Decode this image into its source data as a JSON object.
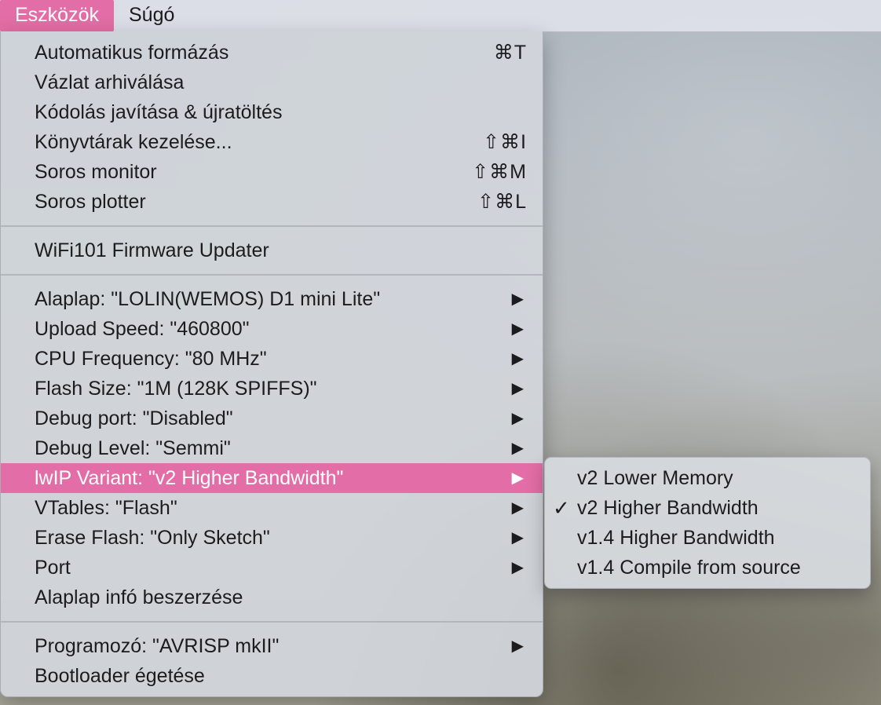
{
  "menubar": {
    "items": [
      {
        "label": "Eszközök",
        "active": true
      },
      {
        "label": "Súgó",
        "active": false
      }
    ]
  },
  "tools_menu": {
    "group1": [
      {
        "label": "Automatikus formázás",
        "shortcut": "⌘T"
      },
      {
        "label": "Vázlat arhiválása",
        "shortcut": ""
      },
      {
        "label": "Kódolás javítása & újratöltés",
        "shortcut": ""
      },
      {
        "label": "Könyvtárak kezelése...",
        "shortcut": "⇧⌘I"
      },
      {
        "label": "Soros monitor",
        "shortcut": "⇧⌘M"
      },
      {
        "label": "Soros plotter",
        "shortcut": "⇧⌘L"
      }
    ],
    "group2": [
      {
        "label": "WiFi101 Firmware Updater"
      }
    ],
    "group3": [
      {
        "label": "Alaplap: \"LOLIN(WEMOS) D1 mini Lite\"",
        "has_submenu": true
      },
      {
        "label": "Upload Speed: \"460800\"",
        "has_submenu": true
      },
      {
        "label": "CPU Frequency: \"80 MHz\"",
        "has_submenu": true
      },
      {
        "label": "Flash Size: \"1M (128K SPIFFS)\"",
        "has_submenu": true
      },
      {
        "label": "Debug port: \"Disabled\"",
        "has_submenu": true
      },
      {
        "label": "Debug Level: \"Semmi\"",
        "has_submenu": true
      },
      {
        "label": "lwIP Variant: \"v2 Higher Bandwidth\"",
        "has_submenu": true,
        "highlighted": true
      },
      {
        "label": "VTables: \"Flash\"",
        "has_submenu": true
      },
      {
        "label": "Erase Flash: \"Only Sketch\"",
        "has_submenu": true
      },
      {
        "label": "Port",
        "has_submenu": true
      },
      {
        "label": "Alaplap infó beszerzése",
        "has_submenu": false
      }
    ],
    "group4": [
      {
        "label": "Programozó: \"AVRISP mkII\"",
        "has_submenu": true
      },
      {
        "label": "Bootloader égetése",
        "has_submenu": false
      }
    ],
    "submenu_arrow": "▶"
  },
  "lwip_submenu": {
    "check_glyph": "✓",
    "items": [
      {
        "label": "v2 Lower Memory",
        "checked": false
      },
      {
        "label": "v2 Higher Bandwidth",
        "checked": true
      },
      {
        "label": "v1.4 Higher Bandwidth",
        "checked": false
      },
      {
        "label": "v1.4 Compile from source",
        "checked": false
      }
    ]
  },
  "colors": {
    "highlight": "#e36da6",
    "menu_background": "#d2d6dc",
    "text": "#1c1c1e"
  }
}
